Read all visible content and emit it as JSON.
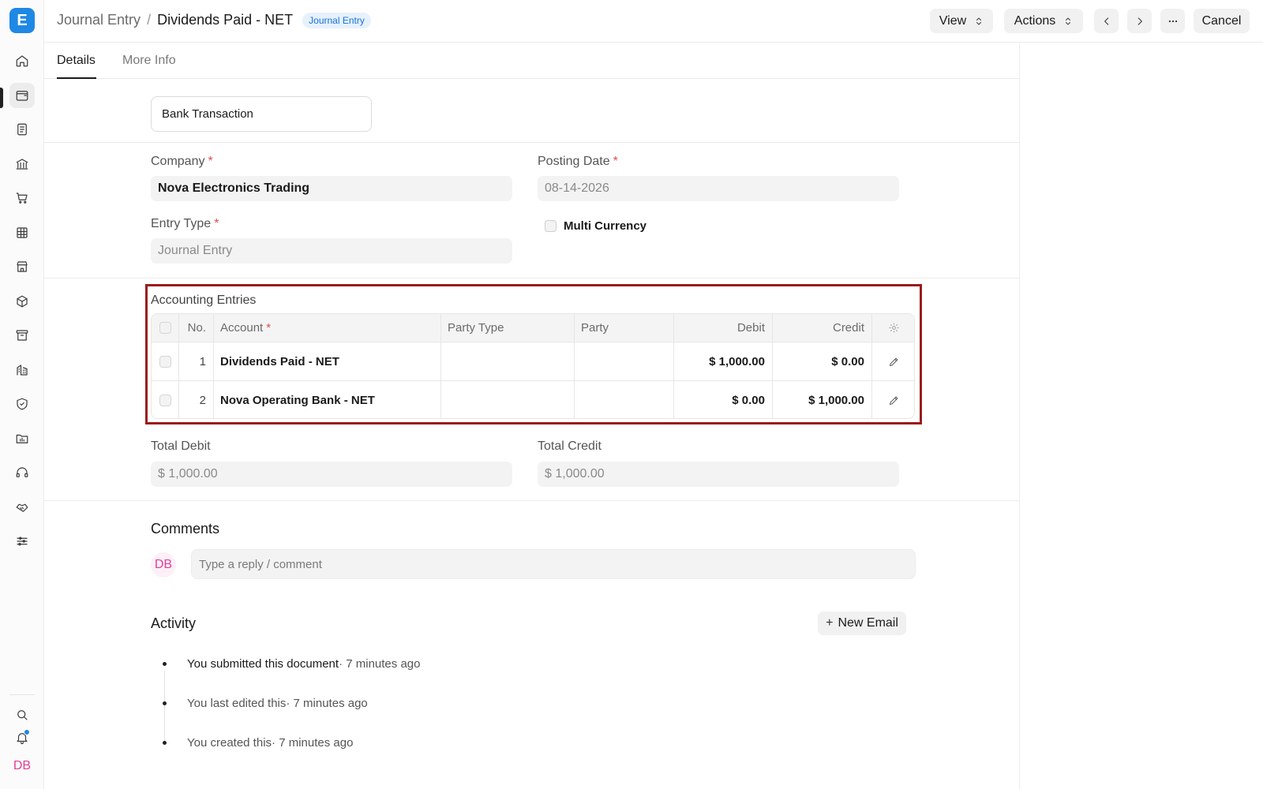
{
  "app": {
    "logo_letter": "E"
  },
  "sidebar": {
    "icons": [
      "home-icon",
      "wallet-icon",
      "document-icon",
      "bank-icon",
      "cart-icon",
      "table-icon",
      "store-icon",
      "box-icon",
      "archive-icon",
      "building-icon",
      "shield-icon",
      "folder-chart-icon",
      "headset-icon",
      "handshake-icon",
      "sliders-icon"
    ],
    "user_initials": "DB"
  },
  "header": {
    "breadcrumb_parent": "Journal Entry",
    "breadcrumb_separator": "/",
    "title": "Dividends Paid - NET",
    "badge": "Journal Entry",
    "view_label": "View",
    "actions_label": "Actions",
    "cancel_label": "Cancel"
  },
  "tabs": [
    {
      "label": "Details",
      "active": true
    },
    {
      "label": "More Info",
      "active": false
    }
  ],
  "form": {
    "bank_transaction_label": "Bank Transaction",
    "company_label": "Company",
    "company_value": "Nova Electronics Trading",
    "posting_date_label": "Posting Date",
    "posting_date_value": "08-14-2026",
    "entry_type_label": "Entry Type",
    "entry_type_value": "Journal Entry",
    "multi_currency_label": "Multi Currency",
    "required_mark": "*"
  },
  "accounting": {
    "title": "Accounting Entries",
    "columns": {
      "no": "No.",
      "account": "Account",
      "party_type": "Party Type",
      "party": "Party",
      "debit": "Debit",
      "credit": "Credit"
    },
    "rows": [
      {
        "no": "1",
        "account": "Dividends Paid - NET",
        "party_type": "",
        "party": "",
        "debit": "$ 1,000.00",
        "credit": "$ 0.00"
      },
      {
        "no": "2",
        "account": "Nova Operating Bank - NET",
        "party_type": "",
        "party": "",
        "debit": "$ 0.00",
        "credit": "$ 1,000.00"
      }
    ]
  },
  "totals": {
    "total_debit_label": "Total Debit",
    "total_debit_value": "$ 1,000.00",
    "total_credit_label": "Total Credit",
    "total_credit_value": "$ 1,000.00"
  },
  "comments": {
    "title": "Comments",
    "avatar_initials": "DB",
    "placeholder": "Type a reply / comment"
  },
  "activity": {
    "title": "Activity",
    "new_email_label": "New Email",
    "items": [
      {
        "text": "You submitted this document",
        "ago": " · 7 minutes ago"
      },
      {
        "text": "You last edited this",
        "ago": " · 7 minutes ago"
      },
      {
        "text": "You created this",
        "ago": " · 7 minutes ago"
      }
    ]
  },
  "colors": {
    "accent": "#1e88e5",
    "highlight_border": "#9b1c1c",
    "required": "#e24c4c",
    "avatar": "#e0409a"
  }
}
